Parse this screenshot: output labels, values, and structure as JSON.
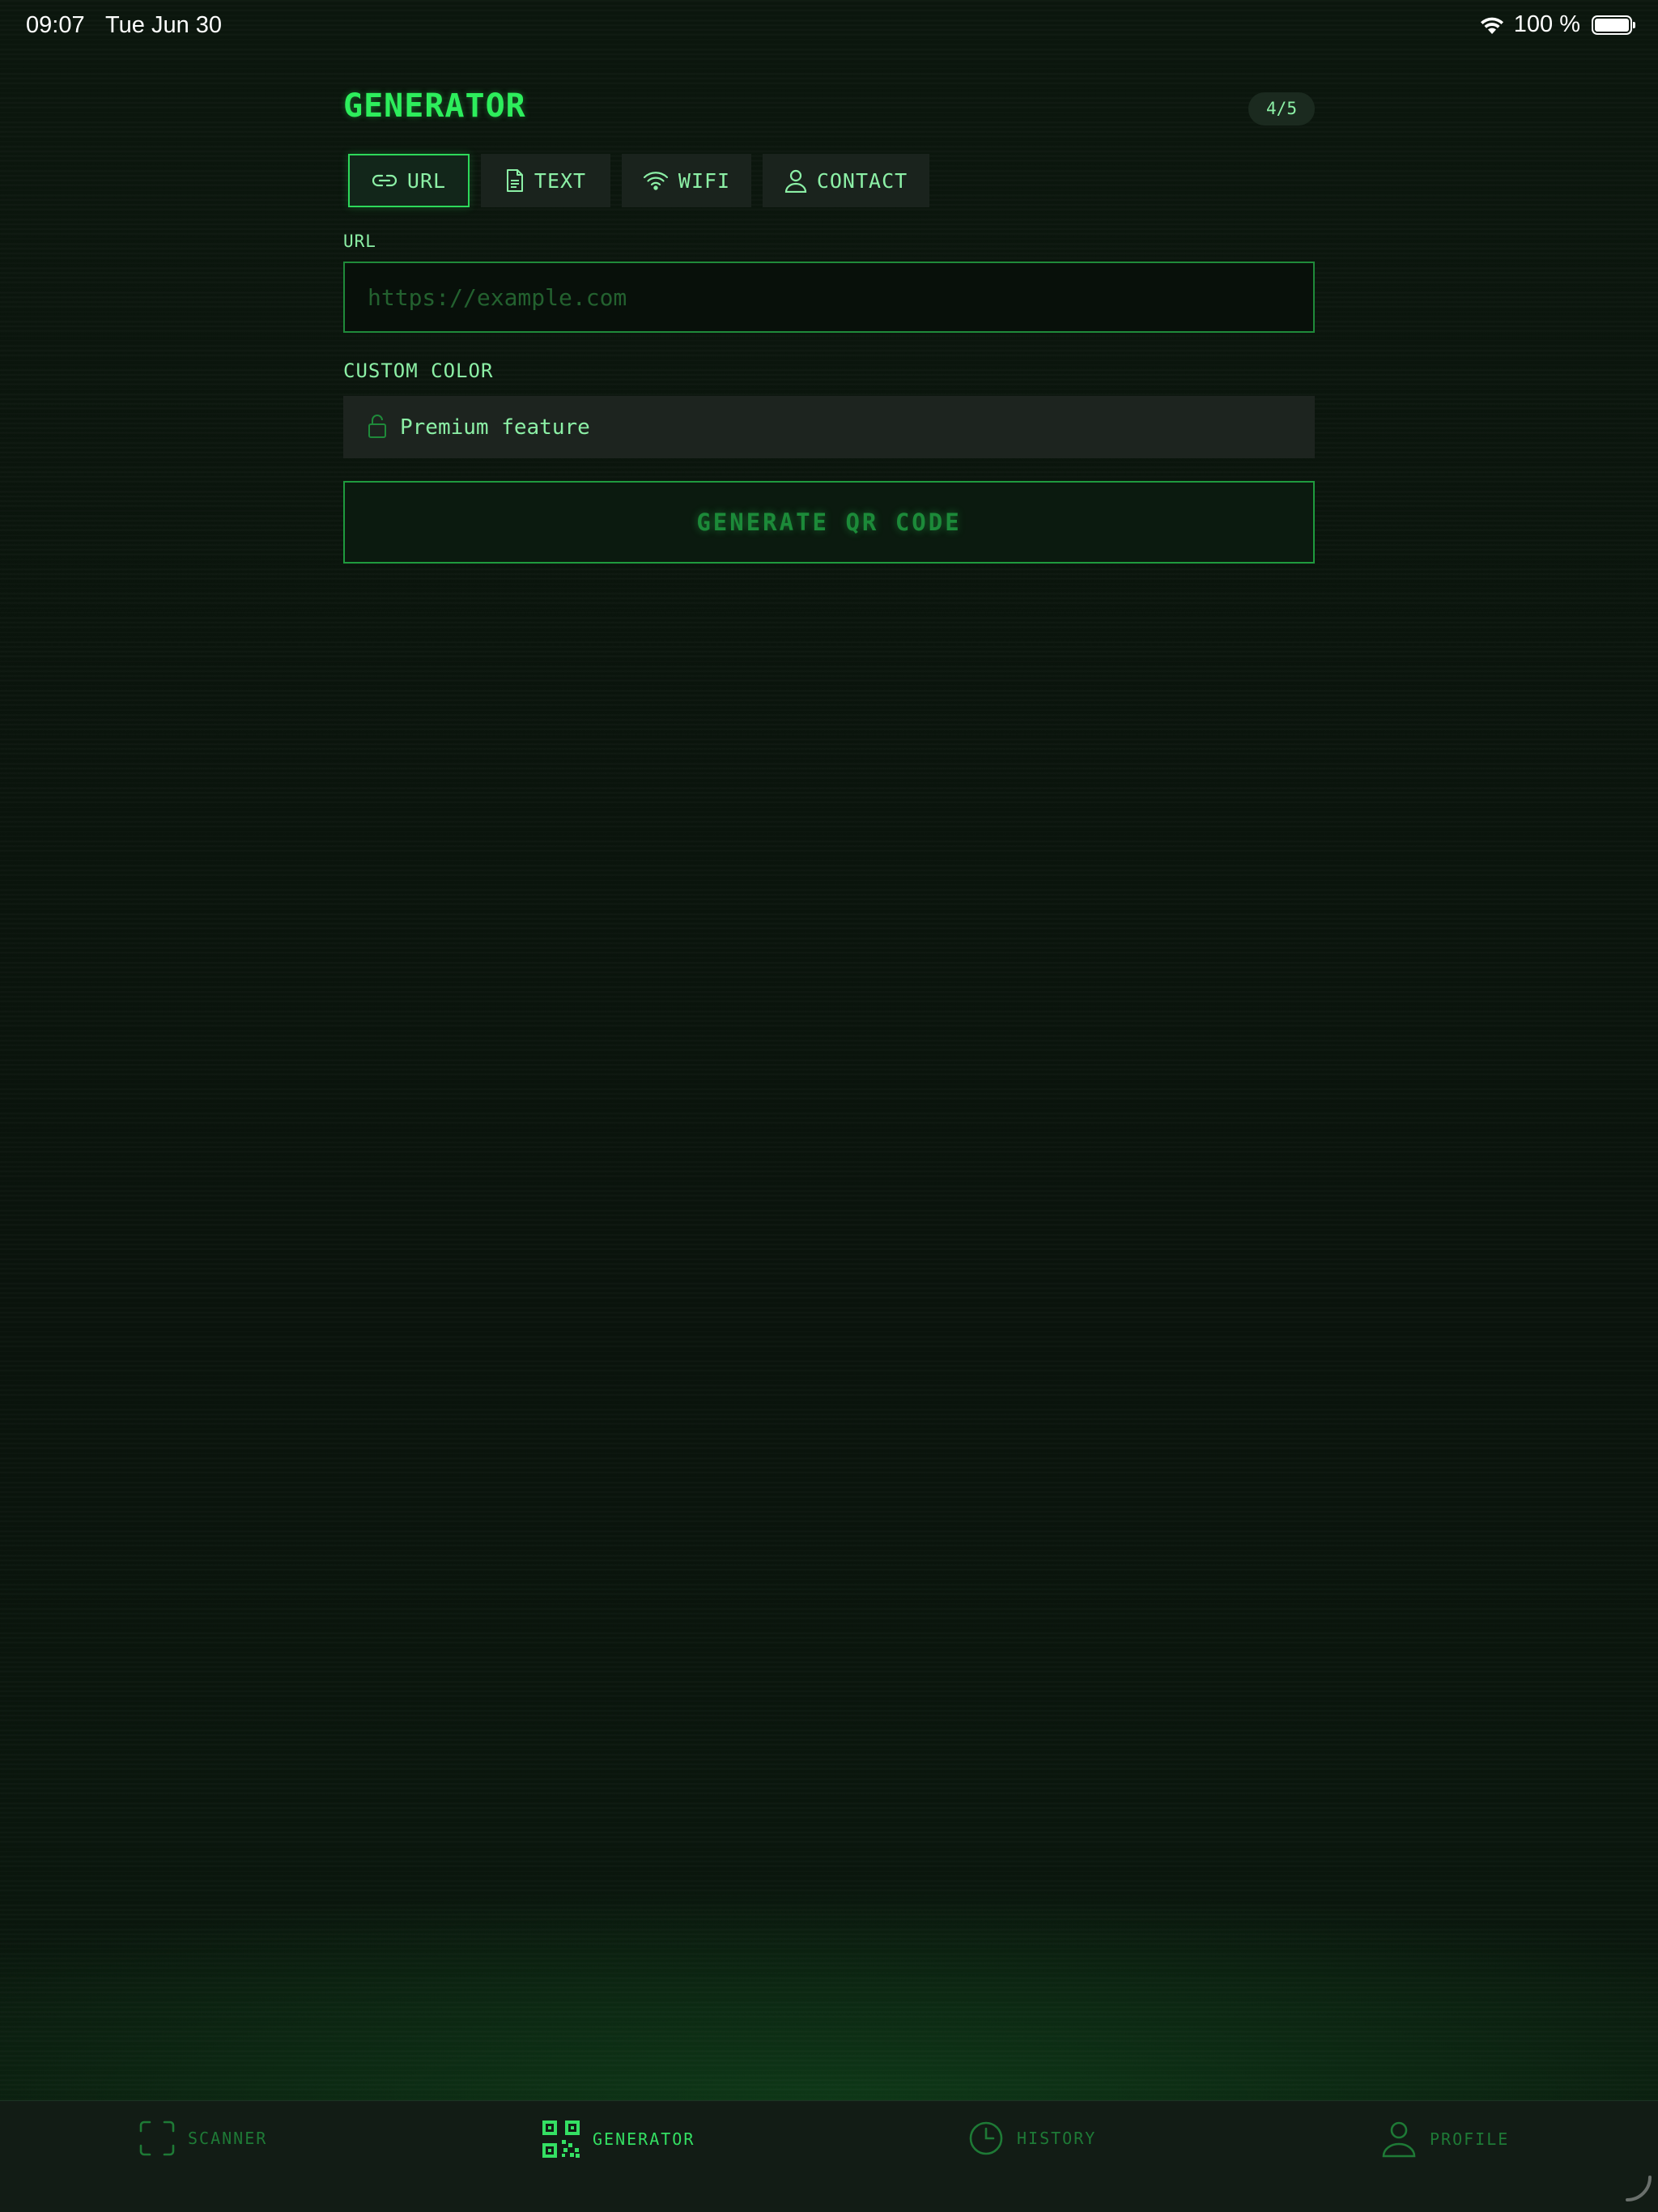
{
  "status_bar": {
    "time": "09:07",
    "date": "Tue Jun 30",
    "battery": "100 %"
  },
  "header": {
    "title": "GENERATOR",
    "step": "4/5"
  },
  "tabs": [
    {
      "label": "URL",
      "icon": "link-icon",
      "active": true
    },
    {
      "label": "TEXT",
      "icon": "document-icon",
      "active": false
    },
    {
      "label": "WIFI",
      "icon": "wifi-icon",
      "active": false
    },
    {
      "label": "CONTACT",
      "icon": "person-icon",
      "active": false
    }
  ],
  "form": {
    "url_label": "URL",
    "url_placeholder": "https://example.com",
    "url_value": "",
    "custom_color_label": "CUSTOM COLOR",
    "premium_text": "Premium feature",
    "generate_label": "GENERATE QR CODE"
  },
  "nav": [
    {
      "label": "SCANNER",
      "icon": "scan-frame-icon",
      "active": false
    },
    {
      "label": "GENERATOR",
      "icon": "qr-code-icon",
      "active": true
    },
    {
      "label": "HISTORY",
      "icon": "clock-icon",
      "active": false
    },
    {
      "label": "PROFILE",
      "icon": "person-icon",
      "active": false
    }
  ],
  "colors": {
    "accent": "#2dee5c",
    "text": "#8cf0a6",
    "background": "#0a140c",
    "muted": "#1e7a36"
  }
}
